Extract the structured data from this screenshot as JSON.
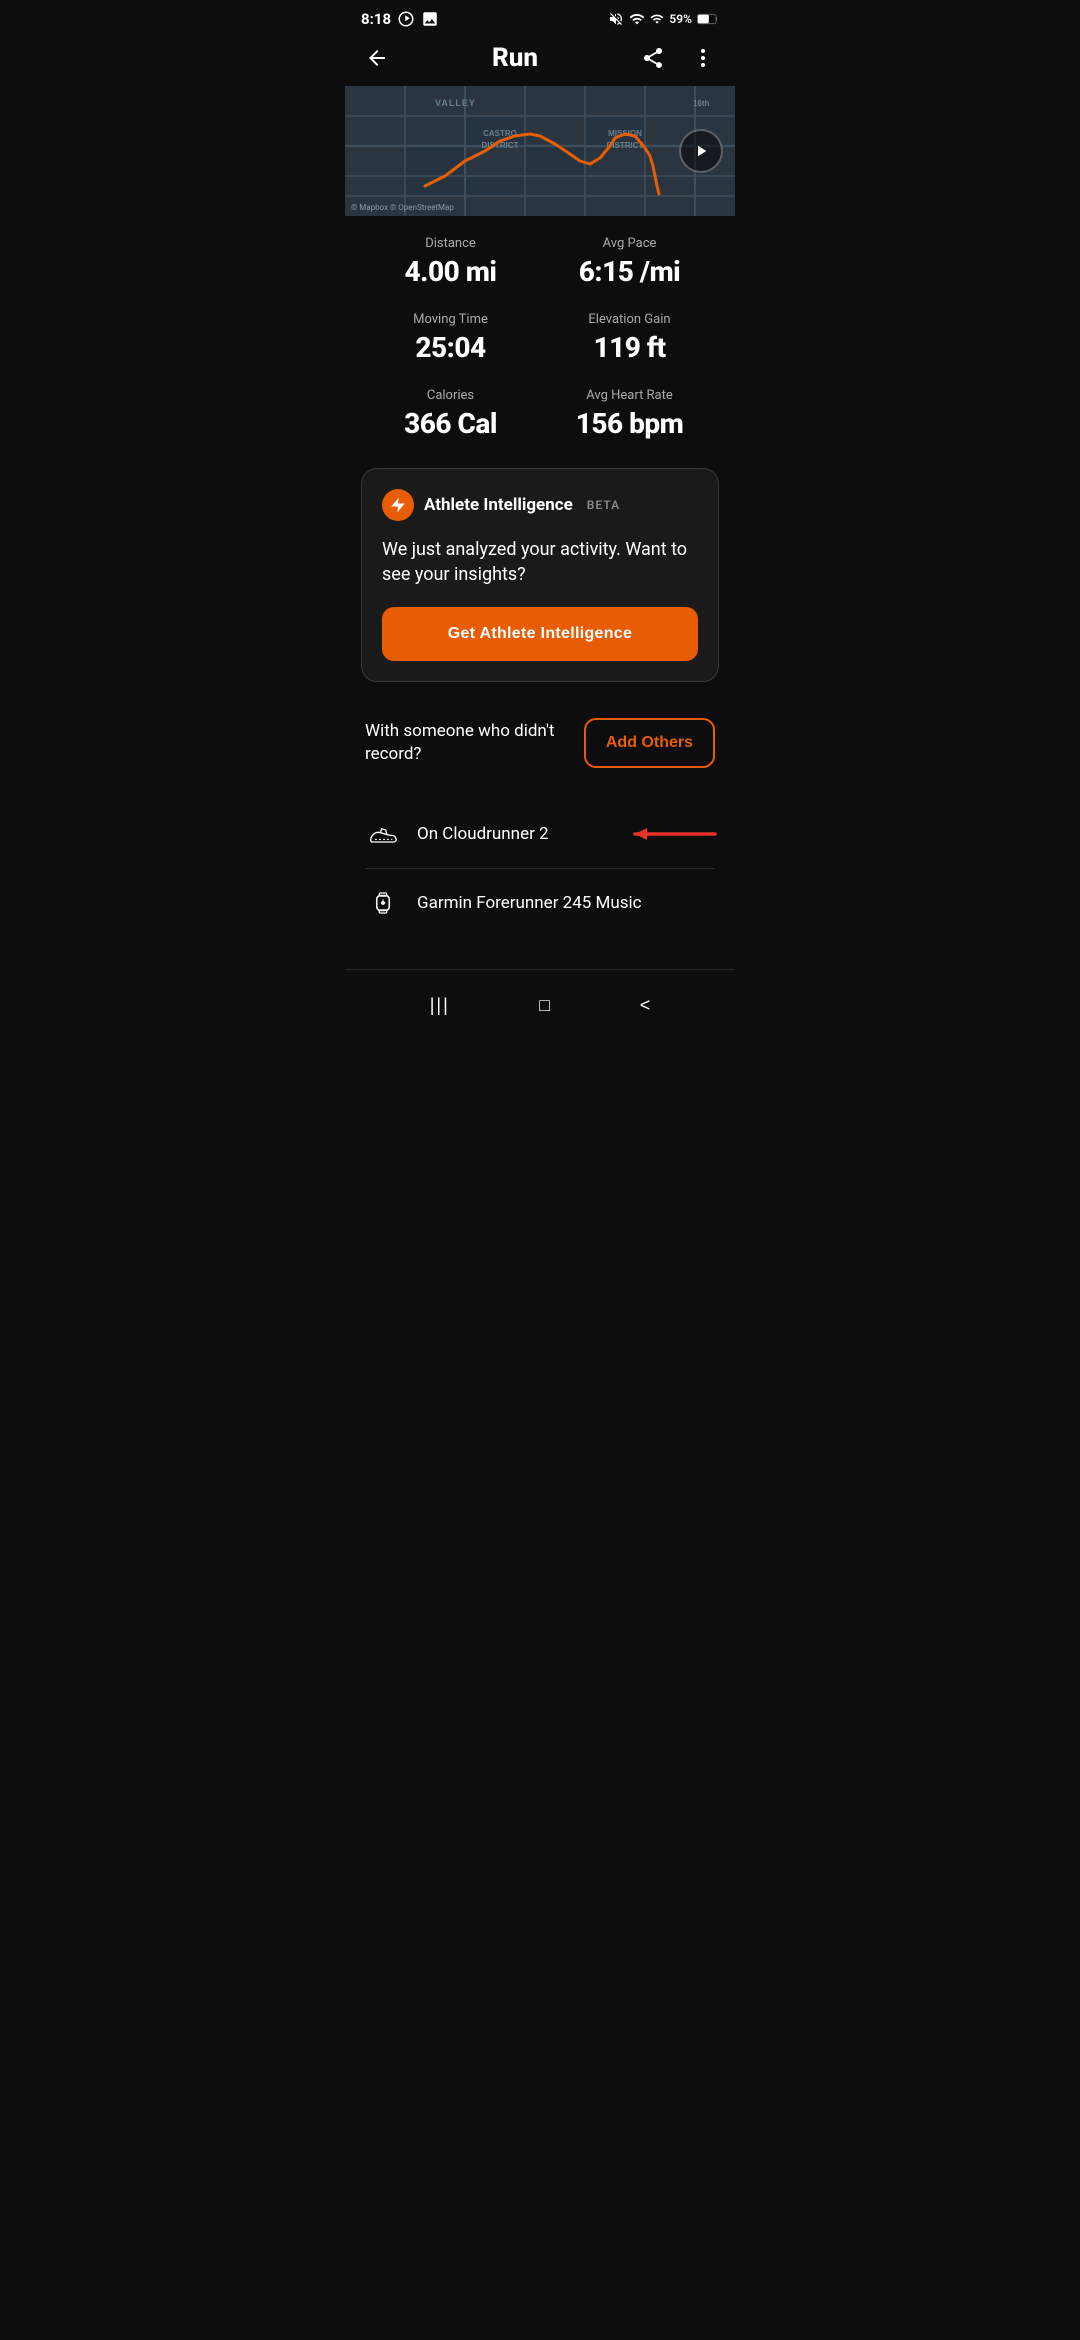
{
  "statusBar": {
    "time": "8:18",
    "batteryPercent": "59%",
    "icons": {
      "mute": "🔇",
      "wifi": "wifi-icon",
      "signal": "signal-icon",
      "battery": "battery-icon",
      "messenger": "messenger-icon",
      "gallery": "gallery-icon"
    }
  },
  "header": {
    "backLabel": "←",
    "title": "Run",
    "shareLabel": "share-icon",
    "moreLabel": "more-icon"
  },
  "map": {
    "copyright": "© Mapbox © OpenStreetMap",
    "labels": {
      "valley": "VALLEY",
      "castro": "CASTRO\nDISTRICT",
      "mission": "MISSION\nDISTRICT",
      "street16": "16th"
    },
    "playButton": "▷"
  },
  "stats": [
    {
      "label": "Distance",
      "value": "4.00 mi"
    },
    {
      "label": "Avg Pace",
      "value": "6:15 /mi"
    },
    {
      "label": "Moving Time",
      "value": "25:04"
    },
    {
      "label": "Elevation Gain",
      "value": "119 ft"
    },
    {
      "label": "Calories",
      "value": "366 Cal"
    },
    {
      "label": "Avg Heart Rate",
      "value": "156 bpm"
    }
  ],
  "athleteIntelligence": {
    "icon": "⚡",
    "title": "Athlete Intelligence",
    "beta": "BETA",
    "description": "We just analyzed your activity. Want to see your insights?",
    "buttonLabel": "Get Athlete Intelligence"
  },
  "withSomeone": {
    "text": "With someone who didn't record?",
    "buttonLabel": "Add Others"
  },
  "gear": [
    {
      "name": "On Cloudrunner 2",
      "iconType": "shoe"
    },
    {
      "name": "Garmin Forerunner 245 Music",
      "iconType": "watch"
    }
  ],
  "navBar": {
    "items": [
      "|||",
      "□",
      "<"
    ]
  },
  "colors": {
    "accent": "#e85d04",
    "background": "#0d0d0d",
    "cardBackground": "#1a1a1a",
    "textPrimary": "#ffffff",
    "textSecondary": "#aaaaaa"
  }
}
